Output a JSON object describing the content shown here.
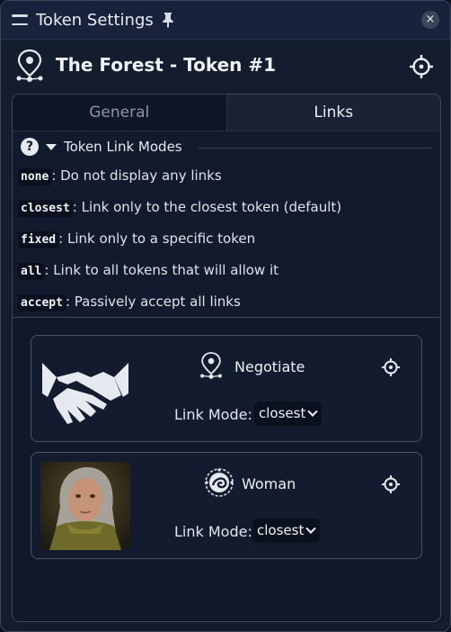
{
  "window": {
    "title": "Token Settings",
    "close_label": "×"
  },
  "header": {
    "token_name": "The Forest - Token #1"
  },
  "tabs": [
    {
      "label": "General"
    },
    {
      "label": "Links"
    }
  ],
  "link_modes": {
    "heading": "Token Link Modes",
    "help_label": "?",
    "items": [
      {
        "mode": "none",
        "description": ": Do not display any links"
      },
      {
        "mode": "closest",
        "description": ": Link only to the closest token (default)"
      },
      {
        "mode": "fixed",
        "description": ": Link only to a specific token"
      },
      {
        "mode": "all",
        "description": ": Link to all tokens that will allow it"
      },
      {
        "mode": "accept",
        "description": ": Passively accept all links"
      }
    ]
  },
  "links": [
    {
      "name": "Negotiate",
      "link_mode_label": "Link Mode:",
      "link_mode_value": "closest",
      "icon": "location-pin-icon",
      "image": "handshake-icon"
    },
    {
      "name": "Woman",
      "link_mode_label": "Link Mode:",
      "link_mode_value": "closest",
      "icon": "swirl-badge-icon",
      "image": "woman-portrait"
    }
  ],
  "colors": {
    "background": "#141d2d",
    "titlebar": "#18223a",
    "border": "#3b4656",
    "text": "#e6e9f0"
  }
}
